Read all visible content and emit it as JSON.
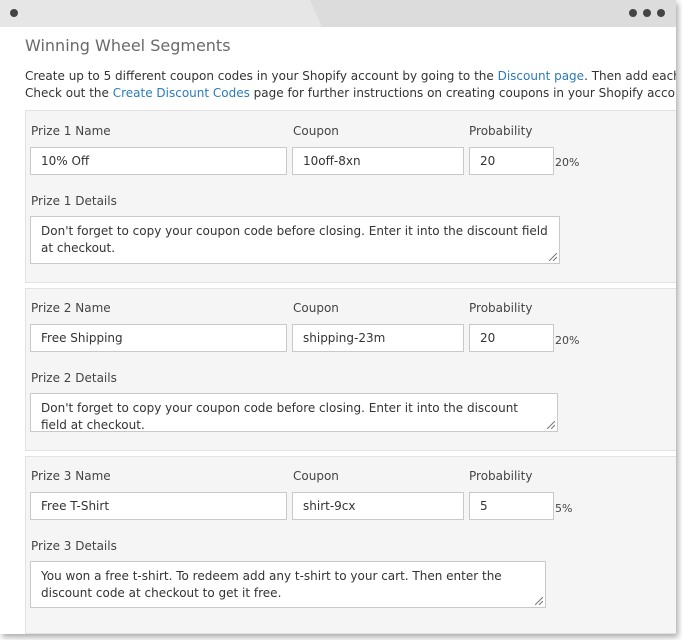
{
  "section_title": "Winning Wheel Segments",
  "intro": {
    "line1_prefix": "Create up to 5 different coupon codes in your Shopify account by going to the ",
    "discount_link": "Discount page",
    "line1_suffix": ". Then add each coupon code in the",
    "line2_prefix": "Check out the ",
    "create_link": "Create Discount Codes",
    "line2_suffix": " page for further instructions on creating coupons in your Shopify account."
  },
  "labels": {
    "coupon": "Coupon",
    "probability": "Probability"
  },
  "prizes": [
    {
      "name_label": "Prize 1 Name",
      "name": "10% Off",
      "coupon": "10off-8xn",
      "probability": "20",
      "percent": "20%",
      "details_label": "Prize 1 Details",
      "details": "Don't forget to copy your coupon code before closing. Enter it into the discount field at checkout."
    },
    {
      "name_label": "Prize 2 Name",
      "name": "Free Shipping",
      "coupon": "shipping-23m",
      "probability": "20",
      "percent": "20%",
      "details_label": "Prize 2 Details",
      "details": "Don't forget to copy your coupon code before closing. Enter it into the discount field at checkout."
    },
    {
      "name_label": "Prize 3 Name",
      "name": "Free T-Shirt",
      "coupon": "shirt-9cx",
      "probability": "5",
      "percent": "5%",
      "details_label": "Prize 3 Details",
      "details": "You won a free t-shirt. To redeem add any t-shirt to your cart. Then enter the discount code at checkout to get it free."
    }
  ]
}
